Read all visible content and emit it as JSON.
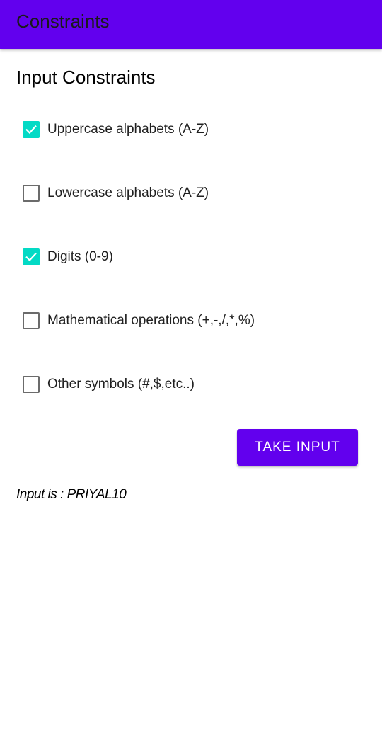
{
  "app_bar": {
    "title": "Constraints",
    "color": "#6200ee"
  },
  "section_title": "Input Constraints",
  "options": [
    {
      "label": "Uppercase alphabets (A-Z)",
      "checked": true
    },
    {
      "label": "Lowercase alphabets (A-Z)",
      "checked": false
    },
    {
      "label": "Digits (0-9)",
      "checked": true
    },
    {
      "label": "Mathematical operations (+,-,/,*,%)",
      "checked": false
    },
    {
      "label": "Other symbols (#,$,etc..)",
      "checked": false
    }
  ],
  "checkbox_checked_color": "#03dac5",
  "check_icon": "checkmark-icon",
  "take_input_button": {
    "label": "TAKE INPUT"
  },
  "result": "Input is : PRIYAL10"
}
